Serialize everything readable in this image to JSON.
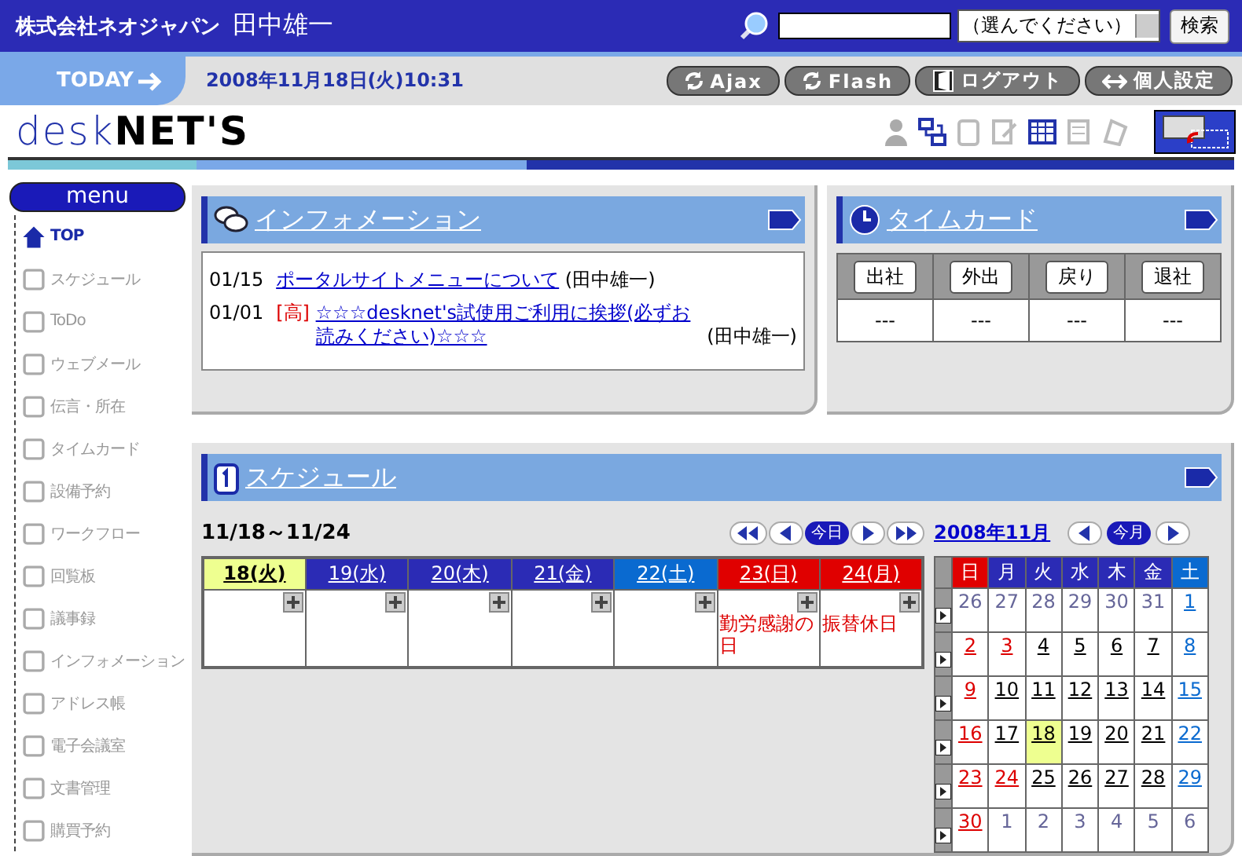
{
  "header": {
    "company": "株式会社ネオジャパン",
    "user": "田中雄一",
    "select": "（選んでください）",
    "search_button": "検索"
  },
  "datebar": {
    "today_label": "TODAY",
    "datetime": "2008年11月18日(火)10:31",
    "buttons": [
      {
        "label": "Ajax",
        "kind": "reload"
      },
      {
        "label": "Flash",
        "kind": "reload"
      },
      {
        "label": "ログアウト",
        "kind": "door"
      },
      {
        "label": "個人設定",
        "kind": "swap"
      }
    ]
  },
  "logo": {
    "part1": "desk",
    "part2": "NET'S"
  },
  "menu": {
    "title": "menu",
    "items": [
      {
        "label": "TOP",
        "selected": true
      },
      {
        "label": "スケジュール",
        "selected": false
      },
      {
        "label": "ToDo",
        "selected": false
      },
      {
        "label": "ウェブメール",
        "selected": false
      },
      {
        "label": "伝言・所在",
        "selected": false
      },
      {
        "label": "タイムカード",
        "selected": false
      },
      {
        "label": "設備予約",
        "selected": false
      },
      {
        "label": "ワークフロー",
        "selected": false
      },
      {
        "label": "回覧板",
        "selected": false
      },
      {
        "label": "議事録",
        "selected": false
      },
      {
        "label": "インフォメーション",
        "selected": false
      },
      {
        "label": "アドレス帳",
        "selected": false
      },
      {
        "label": "電子会議室",
        "selected": false
      },
      {
        "label": "文書管理",
        "selected": false
      },
      {
        "label": "購買予約",
        "selected": false
      }
    ]
  },
  "information": {
    "title": "インフォメーション",
    "items": [
      {
        "date": "01/15",
        "title": "ポータルサイトメニューについて",
        "author": "(田中雄一)"
      },
      {
        "date": "01/01",
        "tag": "[高]",
        "title": "☆☆☆desknet's試使用ご利用に挨拶(必ずお読みください)☆☆☆",
        "author": "(田中雄一)"
      }
    ]
  },
  "timecard": {
    "title": "タイムカード",
    "columns": [
      {
        "button": "出社",
        "value": "---"
      },
      {
        "button": "外出",
        "value": "---"
      },
      {
        "button": "戻り",
        "value": "---"
      },
      {
        "button": "退社",
        "value": "---"
      }
    ]
  },
  "schedule": {
    "title": "スケジュール",
    "range": "11/18～11/24",
    "today_button": "今日",
    "month": "2008年11月",
    "this_month_button": "今月",
    "days": [
      {
        "label": "18(火)",
        "kind": "today"
      },
      {
        "label": "19(水)",
        "kind": "weekday"
      },
      {
        "label": "20(木)",
        "kind": "weekday"
      },
      {
        "label": "21(金)",
        "kind": "weekday"
      },
      {
        "label": "22(土)",
        "kind": "saturday"
      },
      {
        "label": "23(日)",
        "kind": "holiday",
        "events": [
          "勤労感謝の日"
        ]
      },
      {
        "label": "24(月)",
        "kind": "holiday",
        "events": [
          "振替休日"
        ]
      }
    ],
    "calendar": {
      "weekdays": [
        {
          "label": "日",
          "kind": "holiday"
        },
        {
          "label": "月",
          "kind": "weekday"
        },
        {
          "label": "火",
          "kind": "weekday"
        },
        {
          "label": "水",
          "kind": "weekday"
        },
        {
          "label": "木",
          "kind": "weekday"
        },
        {
          "label": "金",
          "kind": "weekday"
        },
        {
          "label": "土",
          "kind": "saturday"
        }
      ],
      "weeks": [
        [
          {
            "day": "26",
            "kind": "outside",
            "selected": false
          },
          {
            "day": "27",
            "kind": "outside",
            "selected": false
          },
          {
            "day": "28",
            "kind": "outside",
            "selected": false
          },
          {
            "day": "29",
            "kind": "outside",
            "selected": false
          },
          {
            "day": "30",
            "kind": "outside",
            "selected": false
          },
          {
            "day": "31",
            "kind": "outside",
            "selected": false
          },
          {
            "day": "1",
            "kind": "saturday",
            "selected": false
          }
        ],
        [
          {
            "day": "2",
            "kind": "holiday",
            "selected": false
          },
          {
            "day": "3",
            "kind": "holiday",
            "selected": false
          },
          {
            "day": "4",
            "kind": "weekday",
            "selected": false
          },
          {
            "day": "5",
            "kind": "weekday",
            "selected": false
          },
          {
            "day": "6",
            "kind": "weekday",
            "selected": false
          },
          {
            "day": "7",
            "kind": "weekday",
            "selected": false
          },
          {
            "day": "8",
            "kind": "saturday",
            "selected": false
          }
        ],
        [
          {
            "day": "9",
            "kind": "holiday",
            "selected": false
          },
          {
            "day": "10",
            "kind": "weekday",
            "selected": false
          },
          {
            "day": "11",
            "kind": "weekday",
            "selected": false
          },
          {
            "day": "12",
            "kind": "weekday",
            "selected": false
          },
          {
            "day": "13",
            "kind": "weekday",
            "selected": false
          },
          {
            "day": "14",
            "kind": "weekday",
            "selected": false
          },
          {
            "day": "15",
            "kind": "saturday",
            "selected": false
          }
        ],
        [
          {
            "day": "16",
            "kind": "holiday",
            "selected": false
          },
          {
            "day": "17",
            "kind": "weekday",
            "selected": false
          },
          {
            "day": "18",
            "kind": "weekday",
            "selected": true
          },
          {
            "day": "19",
            "kind": "weekday",
            "selected": false
          },
          {
            "day": "20",
            "kind": "weekday",
            "selected": false
          },
          {
            "day": "21",
            "kind": "weekday",
            "selected": false
          },
          {
            "day": "22",
            "kind": "saturday",
            "selected": false
          }
        ],
        [
          {
            "day": "23",
            "kind": "holiday",
            "selected": false
          },
          {
            "day": "24",
            "kind": "holiday",
            "selected": false
          },
          {
            "day": "25",
            "kind": "weekday",
            "selected": false
          },
          {
            "day": "26",
            "kind": "weekday",
            "selected": false
          },
          {
            "day": "27",
            "kind": "weekday",
            "selected": false
          },
          {
            "day": "28",
            "kind": "weekday",
            "selected": false
          },
          {
            "day": "29",
            "kind": "saturday",
            "selected": false
          }
        ],
        [
          {
            "day": "30",
            "kind": "holiday",
            "selected": false
          },
          {
            "day": "1",
            "kind": "outside",
            "selected": false
          },
          {
            "day": "2",
            "kind": "outside",
            "selected": false
          },
          {
            "day": "3",
            "kind": "outside",
            "selected": false
          },
          {
            "day": "4",
            "kind": "outside",
            "selected": false
          },
          {
            "day": "5",
            "kind": "outside",
            "selected": false
          },
          {
            "day": "6",
            "kind": "outside",
            "selected": false
          }
        ]
      ]
    }
  }
}
